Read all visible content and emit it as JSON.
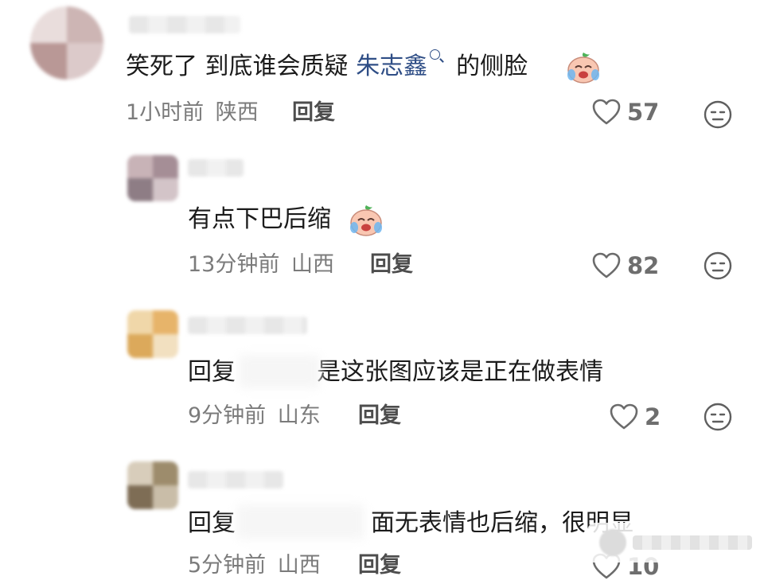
{
  "comments": [
    {
      "text_before": "笑死了 到底谁会质疑 ",
      "mention": "朱志鑫",
      "text_after": "的侧脸",
      "time": "1小时前",
      "location": "陕西",
      "reply_label": "回复",
      "likes": "57",
      "emoji": "crying-laughing-emoji"
    },
    {
      "text": "有点下巴后缩",
      "time": "13分钟前",
      "location": "山西",
      "reply_label": "回复",
      "likes": "82",
      "emoji": "crying-laughing-emoji"
    },
    {
      "reply_prefix": "回复",
      "text": "是这张图应该是正在做表情",
      "time": "9分钟前",
      "location": "山东",
      "reply_label": "回复",
      "likes": "2"
    },
    {
      "reply_prefix": "回复",
      "text": "面无表情也后缩，很明显",
      "time": "5分钟前",
      "location": "山西",
      "reply_label": "回复",
      "likes": "10"
    }
  ],
  "icons": {
    "like": "heart-outline-icon",
    "menu": "expressionless-face-icon",
    "mention_search": "search-icon"
  },
  "colors": {
    "mention": "#2f4e86",
    "meta": "#7b7b7b"
  }
}
